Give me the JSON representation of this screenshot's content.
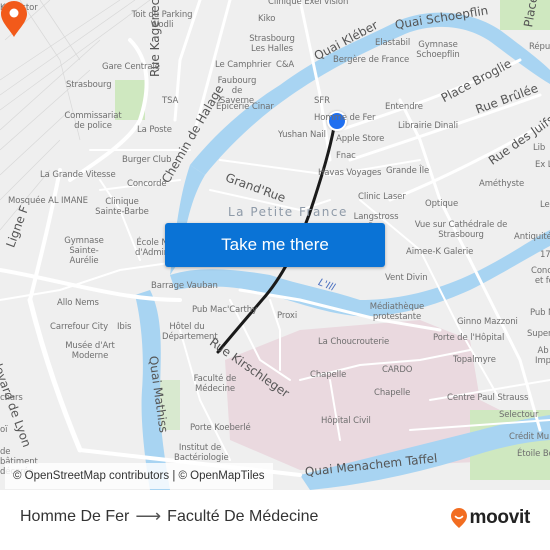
{
  "map": {
    "colors": {
      "background": "#efefef",
      "water": "#a8d4f2",
      "road": "#ffffff",
      "park": "#cfe8c0",
      "hospital": "#ead9df",
      "route": "#1a1a1a",
      "origin": "#1f6ff0",
      "destination": "#f25a1a",
      "button": "#0a73d6"
    },
    "streets": [
      {
        "name": "Quai Kléber"
      },
      {
        "name": "Quai Schoepflin"
      },
      {
        "name": "Place Broglie"
      },
      {
        "name": "Rue Brûlée"
      },
      {
        "name": "Rue des Juifs"
      },
      {
        "name": "Rue Kageneck"
      },
      {
        "name": "Chemin de Halage"
      },
      {
        "name": "Grand'Rue"
      },
      {
        "name": "Ligne F"
      },
      {
        "name": "Boulevard de Lyon"
      },
      {
        "name": "Quai Mathiss"
      },
      {
        "name": "Rue Kirschleger"
      },
      {
        "name": "Quai Menachem Taffel"
      },
      {
        "name": "Place"
      }
    ],
    "district": "La Petite France",
    "river": "L'Ill",
    "pois": [
      {
        "name": "Kriegstor"
      },
      {
        "name": "Toit du Parking Wodli"
      },
      {
        "name": "Clinique Exel vision"
      },
      {
        "name": "Kiko"
      },
      {
        "name": "Strasbourg Les Halles"
      },
      {
        "name": "Le Camphrier"
      },
      {
        "name": "C&A"
      },
      {
        "name": "Gare Centrale"
      },
      {
        "name": "Strasbourg"
      },
      {
        "name": "Faubourg de Saverne"
      },
      {
        "name": "Épicerie Cinar"
      },
      {
        "name": "TSA"
      },
      {
        "name": "Commissariat de police"
      },
      {
        "name": "La Poste"
      },
      {
        "name": "Burger Club"
      },
      {
        "name": "La Grande Vitesse"
      },
      {
        "name": "Concorde"
      },
      {
        "name": "Mosquée AL IMANE"
      },
      {
        "name": "Clinique Sainte-Barbe"
      },
      {
        "name": "Gymnase Sainte-Aurélie"
      },
      {
        "name": "École N d'Admin"
      },
      {
        "name": "Barrage Vauban"
      },
      {
        "name": "Allo Nems"
      },
      {
        "name": "Carrefour City"
      },
      {
        "name": "Ibis"
      },
      {
        "name": "Hôtel du Département"
      },
      {
        "name": "Musée d'Art Moderne"
      },
      {
        "name": "Pub Mac'Carthy"
      },
      {
        "name": "Proxi"
      },
      {
        "name": "Porte Koeberlé"
      },
      {
        "name": "Institut de Bactériologie"
      },
      {
        "name": "chars"
      },
      {
        "name": "oï"
      },
      {
        "name": "de bâtiment décorée"
      },
      {
        "name": "Elastabil"
      },
      {
        "name": "Gymnase Schoepflin"
      },
      {
        "name": "Bergère de France"
      },
      {
        "name": "Répu"
      },
      {
        "name": "SFR"
      },
      {
        "name": "Entendre"
      },
      {
        "name": "Yushan Nail"
      },
      {
        "name": "Apple Store"
      },
      {
        "name": "Librairie Dinali"
      },
      {
        "name": "Fnac"
      },
      {
        "name": "Havas Voyages"
      },
      {
        "name": "Grande Île"
      },
      {
        "name": "Lib"
      },
      {
        "name": "Ex L"
      },
      {
        "name": "Améthyste"
      },
      {
        "name": "Le"
      },
      {
        "name": "Clinic Laser"
      },
      {
        "name": "Optique"
      },
      {
        "name": "Langstross Rue"
      },
      {
        "name": "Vue sur Cathédrale de Strasbourg"
      },
      {
        "name": "Antiquité"
      },
      {
        "name": "17"
      },
      {
        "name": "Aimee-K Galerie"
      },
      {
        "name": "Concep et for"
      },
      {
        "name": "Vent Divin"
      },
      {
        "name": "Médiathèque protestante"
      },
      {
        "name": "Pub N"
      },
      {
        "name": "Ginno Mazzoni"
      },
      {
        "name": "Super"
      },
      {
        "name": "Porte de l'Hôpital"
      },
      {
        "name": "Ab Imp"
      },
      {
        "name": "La Choucrouterie"
      },
      {
        "name": "Topalmyre"
      },
      {
        "name": "CARDO"
      },
      {
        "name": "Chapelle"
      },
      {
        "name": "Chapelle"
      },
      {
        "name": "Centre Paul Strauss"
      },
      {
        "name": "Selectour"
      },
      {
        "name": "Hôpital Civil"
      },
      {
        "name": "Crédit Mu"
      },
      {
        "name": "Étoile Bo"
      }
    ],
    "origin_label": "Homme de Fer",
    "destination_label": "Faculté de Médecine",
    "take_me_there": "Take me there",
    "attribution": "© OpenStreetMap contributors | © OpenMapTiles"
  },
  "footer": {
    "from": "Homme De Fer",
    "arrow": "⟶",
    "to": "Faculté De Médecine",
    "brand": "moovit"
  }
}
